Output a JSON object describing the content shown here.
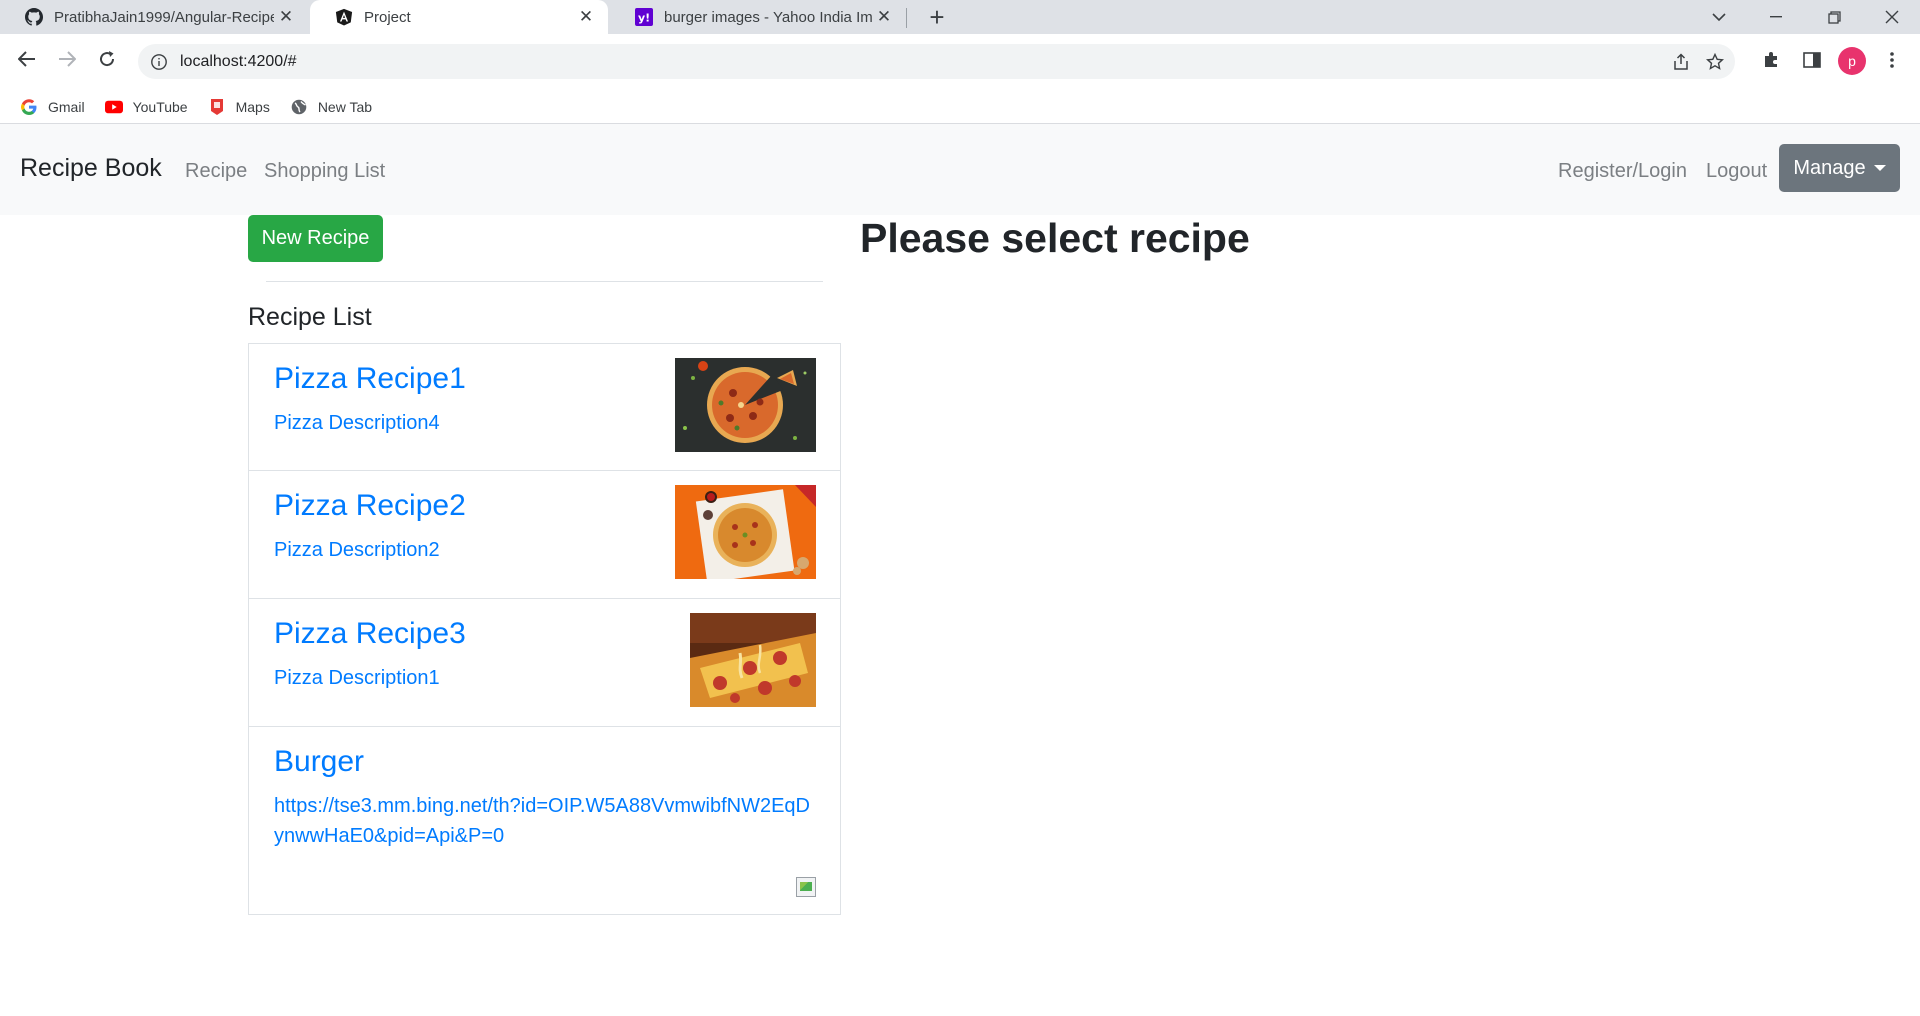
{
  "browser": {
    "tabs": [
      {
        "title": "PratibhaJain1999/Angular-Recipe",
        "icon": "github-icon",
        "active": false
      },
      {
        "title": "Project",
        "icon": "angular-icon",
        "active": true
      },
      {
        "title": "burger images - Yahoo India Ima",
        "icon": "yahoo-icon",
        "active": false
      }
    ],
    "url": "localhost:4200/#",
    "bookmarks": [
      {
        "label": "Gmail",
        "icon": "google-icon"
      },
      {
        "label": "YouTube",
        "icon": "youtube-icon"
      },
      {
        "label": "Maps",
        "icon": "maps-icon"
      },
      {
        "label": "New Tab",
        "icon": "globe-icon"
      }
    ],
    "profile_initial": "p"
  },
  "navbar": {
    "brand": "Recipe Book",
    "links": [
      "Recipe",
      "Shopping List"
    ],
    "right_links": [
      "Register/Login",
      "Logout"
    ],
    "manage_label": "Manage"
  },
  "sidebar": {
    "new_recipe_label": "New Recipe",
    "list_heading": "Recipe List",
    "recipes": [
      {
        "name": "Pizza Recipe1",
        "description": "Pizza Description4",
        "image": "pizza-dark"
      },
      {
        "name": "Pizza Recipe2",
        "description": "Pizza Description2",
        "image": "pizza-orange"
      },
      {
        "name": "Pizza Recipe3",
        "description": "Pizza Description1",
        "image": "pizza-slice"
      },
      {
        "name": "Burger",
        "description": "https://tse3.mm.bing.net/th?id=OIP.W5A88VvmwibfNW2EqDynwwHaE0&pid=Api&P=0",
        "image": "broken"
      }
    ]
  },
  "main": {
    "placeholder": "Please select recipe"
  },
  "colors": {
    "link": "#007bff",
    "success": "#28a745",
    "secondary": "#6c757d"
  }
}
